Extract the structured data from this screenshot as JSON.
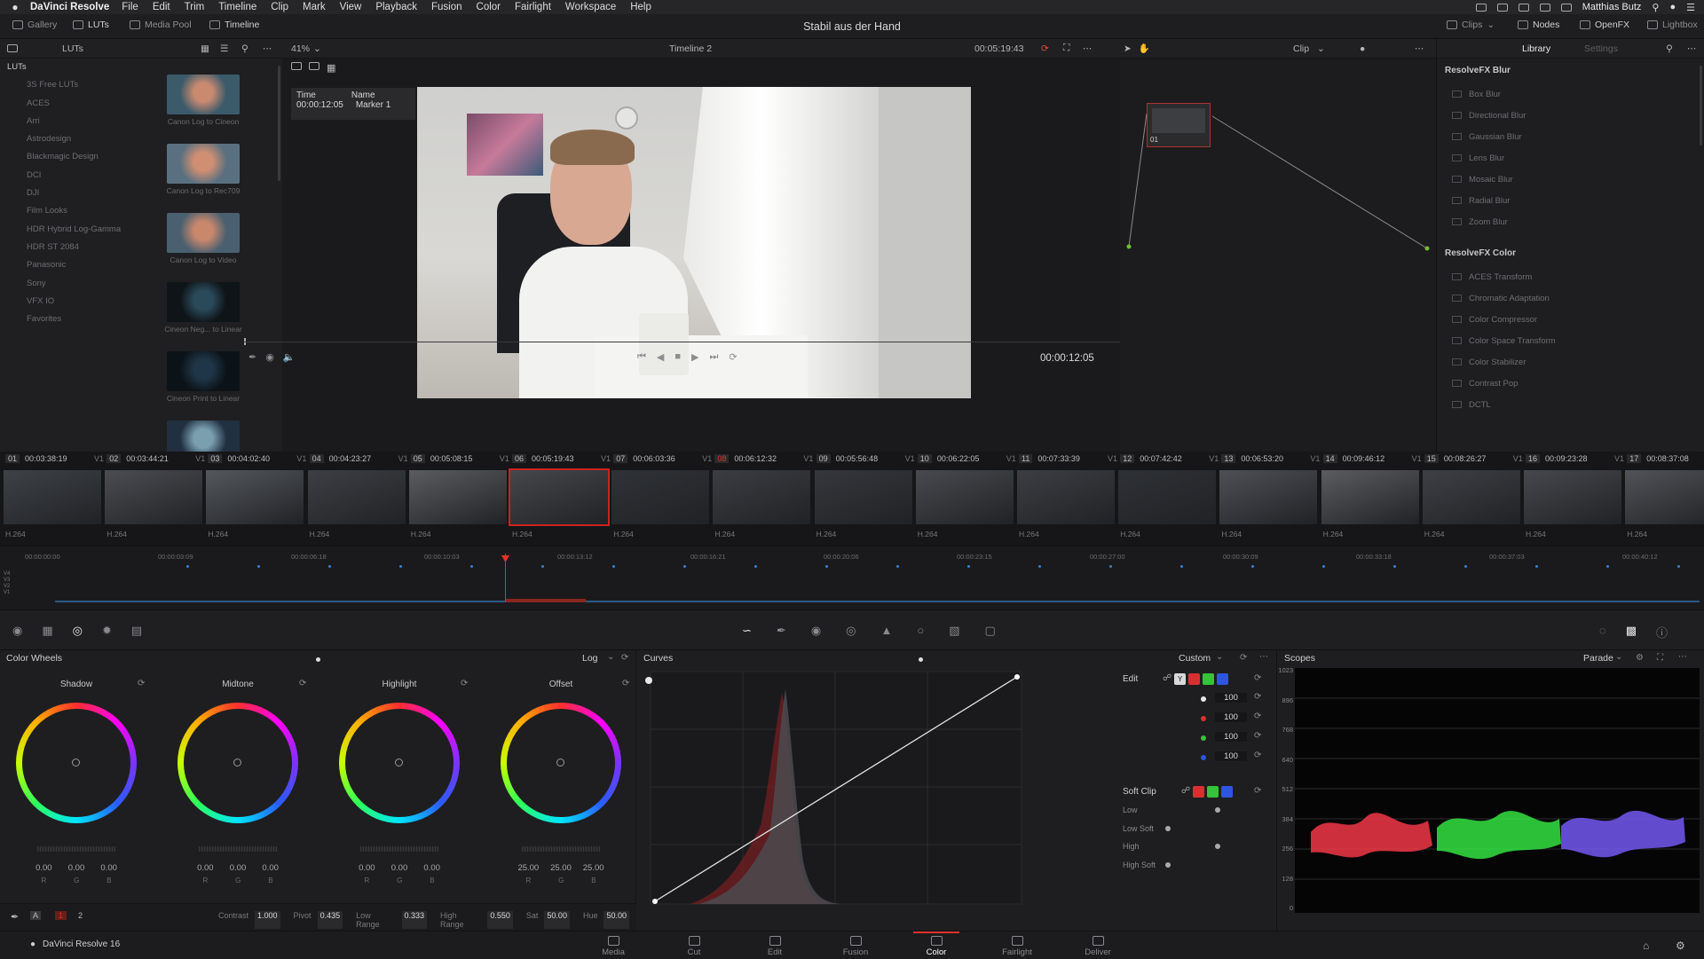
{
  "menu": {
    "app": "DaVinci Resolve",
    "items": [
      "File",
      "Edit",
      "Trim",
      "Timeline",
      "Clip",
      "Mark",
      "View",
      "Playback",
      "Fusion",
      "Color",
      "Fairlight",
      "Workspace",
      "Help"
    ],
    "user": "Matthias Butz"
  },
  "toolbar": {
    "gallery": "Gallery",
    "luts": "LUTs",
    "media_pool": "Media Pool",
    "timeline": "Timeline",
    "project_title": "Stabil aus der Hand",
    "clips": "Clips",
    "nodes": "Nodes",
    "openfx": "OpenFX",
    "lightbox": "Lightbox"
  },
  "luts": {
    "header": "LUTs",
    "tree": [
      "LUTs",
      "3S Free LUTs",
      "ACES",
      "Arri",
      "Astrodesign",
      "Blackmagic Design",
      "DCI",
      "DJI",
      "Film Looks",
      "HDR Hybrid Log-Gamma",
      "HDR ST 2084",
      "Panasonic",
      "Sony",
      "VFX IO",
      "Favorites"
    ],
    "thumbs": [
      "Canon Log to Cineon",
      "Canon Log to Rec709",
      "Canon Log to Video",
      "Cineon Neg... to Linear",
      "Cineon Print to Linear"
    ]
  },
  "viewer": {
    "zoom": "41%",
    "timeline_name": "Timeline 2",
    "timecode_top": "00:05:19:43",
    "clip_mode": "Clip",
    "marker": {
      "time_label": "Time",
      "time": "00:00:12:05",
      "name_label": "Name",
      "name": "Marker 1"
    },
    "timecode": "00:00:12:05"
  },
  "nodes": {
    "node_label": "01"
  },
  "library": {
    "tab_library": "Library",
    "tab_settings": "Settings",
    "sections": [
      {
        "title": "ResolveFX Blur",
        "items": [
          "Box Blur",
          "Directional Blur",
          "Gaussian Blur",
          "Lens Blur",
          "Mosaic Blur",
          "Radial Blur",
          "Zoom Blur"
        ]
      },
      {
        "title": "ResolveFX Color",
        "items": [
          "ACES Transform",
          "Chromatic Adaptation",
          "Color Compressor",
          "Color Space Transform",
          "Color Stabilizer",
          "Contrast Pop",
          "DCTL"
        ]
      }
    ]
  },
  "clips": [
    {
      "n": "01",
      "tc": "00:03:38:19",
      "t": "V1",
      "c": "H.264"
    },
    {
      "n": "02",
      "tc": "00:03:44:21",
      "t": "V1",
      "c": "H.264"
    },
    {
      "n": "03",
      "tc": "00:04:02:40",
      "t": "V1",
      "c": "H.264"
    },
    {
      "n": "04",
      "tc": "00:04:23:27",
      "t": "V1",
      "c": "H.264"
    },
    {
      "n": "05",
      "tc": "00:05:08:15",
      "t": "V1",
      "c": "H.264"
    },
    {
      "n": "06",
      "tc": "00:05:19:43",
      "t": "V1",
      "c": "H.264"
    },
    {
      "n": "07",
      "tc": "00:06:03:36",
      "t": "V1",
      "c": "H.264"
    },
    {
      "n": "08",
      "tc": "00:06:12:32",
      "t": "V1",
      "c": "H.264"
    },
    {
      "n": "09",
      "tc": "00:05:56:48",
      "t": "V1",
      "c": "H.264"
    },
    {
      "n": "10",
      "tc": "00:06:22:05",
      "t": "V1",
      "c": "H.264"
    },
    {
      "n": "11",
      "tc": "00:07:33:39",
      "t": "V1",
      "c": "H.264"
    },
    {
      "n": "12",
      "tc": "00:07:42:42",
      "t": "V1",
      "c": "H.264"
    },
    {
      "n": "13",
      "tc": "00:06:53:20",
      "t": "V1",
      "c": "H.264"
    },
    {
      "n": "14",
      "tc": "00:09:46:12",
      "t": "V1",
      "c": "H.264"
    },
    {
      "n": "15",
      "tc": "00:08:26:27",
      "t": "V1",
      "c": "H.264"
    },
    {
      "n": "16",
      "tc": "00:09:23:28",
      "t": "V1",
      "c": "H.264"
    },
    {
      "n": "17",
      "tc": "00:08:37:08",
      "t": "V1",
      "c": "H.264"
    }
  ],
  "mini_timeline": {
    "ticks": [
      "00:00:00:00",
      "00:00:03:09",
      "00:00:06:18",
      "00:00:10:03",
      "00:00:13:12",
      "00:00:16:21",
      "00:00:20:06",
      "00:00:23:15",
      "00:00:27:00",
      "00:00:30:09",
      "00:00:33:18",
      "00:00:37:03",
      "00:00:40:12"
    ],
    "tracks": [
      "V4",
      "V3",
      "V2",
      "V1"
    ]
  },
  "wheels": {
    "title": "Color Wheels",
    "mode": "Log",
    "items": [
      {
        "name": "Shadow",
        "v": [
          "0.00",
          "0.00",
          "0.00"
        ]
      },
      {
        "name": "Midtone",
        "v": [
          "0.00",
          "0.00",
          "0.00"
        ]
      },
      {
        "name": "Highlight",
        "v": [
          "0.00",
          "0.00",
          "0.00"
        ]
      },
      {
        "name": "Offset",
        "v": [
          "25.00",
          "25.00",
          "25.00"
        ]
      }
    ],
    "rgb": [
      "R",
      "G",
      "B"
    ],
    "page": "2",
    "footer": {
      "contrast_l": "Contrast",
      "contrast": "1.000",
      "pivot_l": "Pivot",
      "pivot": "0.435",
      "lowr_l": "Low Range",
      "lowr": "0.333",
      "highr_l": "High Range",
      "highr": "0.550",
      "sat_l": "Sat",
      "sat": "50.00",
      "hue_l": "Hue",
      "hue": "50.00"
    }
  },
  "curves": {
    "title": "Curves",
    "mode": "Custom",
    "edit_label": "Edit",
    "y": "Y",
    "edit_values": [
      "100",
      "100",
      "100",
      "100"
    ],
    "soft_clip": "Soft Clip",
    "sc": [
      "Low",
      "Low Soft",
      "High",
      "High Soft"
    ]
  },
  "scopes": {
    "title": "Scopes",
    "mode": "Parade",
    "scale": [
      "1023",
      "896",
      "768",
      "640",
      "512",
      "384",
      "256",
      "128",
      "0"
    ]
  },
  "footer": {
    "version": "DaVinci Resolve 16",
    "pages": [
      "Media",
      "Cut",
      "Edit",
      "Fusion",
      "Color",
      "Fairlight",
      "Deliver"
    ],
    "active": "Color"
  }
}
